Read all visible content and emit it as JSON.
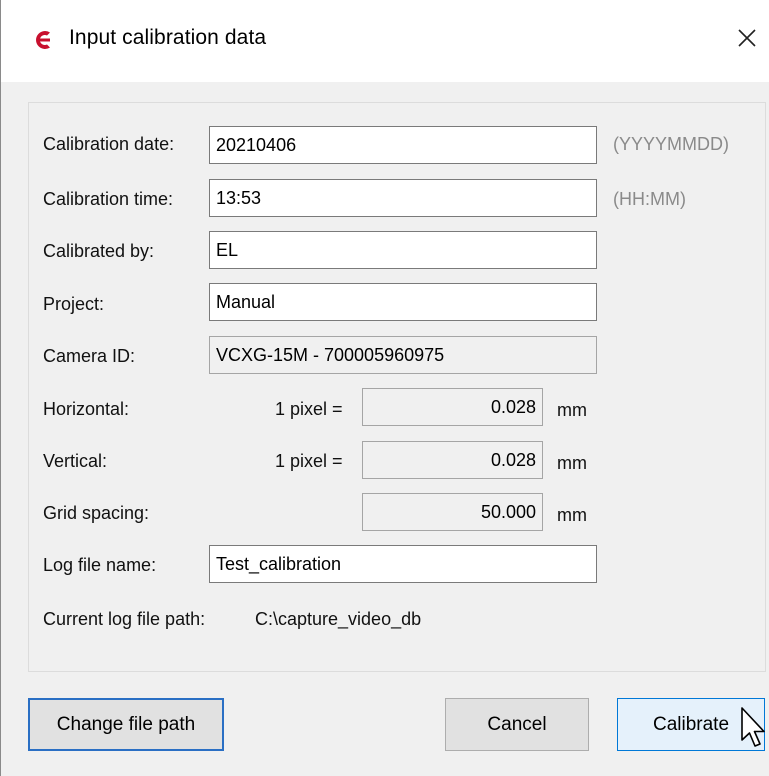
{
  "window": {
    "title": "Input calibration data"
  },
  "form": {
    "calibration_date": {
      "label": "Calibration date:",
      "value": "20210406",
      "hint": "(YYYYMMDD)"
    },
    "calibration_time": {
      "label": "Calibration time:",
      "value": "13:53",
      "hint": "(HH:MM)"
    },
    "calibrated_by": {
      "label": "Calibrated by:",
      "value": "EL"
    },
    "project": {
      "label": "Project:",
      "value": "Manual"
    },
    "camera_id": {
      "label": "Camera ID:",
      "value": "VCXG-15M - 700005960975"
    },
    "horizontal": {
      "label": "Horizontal:",
      "prefix": "1 pixel =",
      "value": "0.028",
      "unit": "mm"
    },
    "vertical": {
      "label": "Vertical:",
      "prefix": "1 pixel =",
      "value": "0.028",
      "unit": "mm"
    },
    "grid_spacing": {
      "label": "Grid spacing:",
      "value": "50.000",
      "unit": "mm"
    },
    "log_file_name": {
      "label": "Log file name:",
      "value": "Test_calibration"
    },
    "current_log_path": {
      "label": "Current log file path:",
      "value": "C:\\capture_video_db"
    }
  },
  "buttons": {
    "change_path": "Change file path",
    "cancel": "Cancel",
    "calibrate": "Calibrate"
  },
  "icons": {
    "app": "app-logo-icon",
    "close": "close-icon",
    "cursor": "mouse-pointer-icon"
  },
  "colors": {
    "accent": "#0078d7",
    "app_icon": "#c8102e",
    "hint": "#8a8a8a"
  }
}
